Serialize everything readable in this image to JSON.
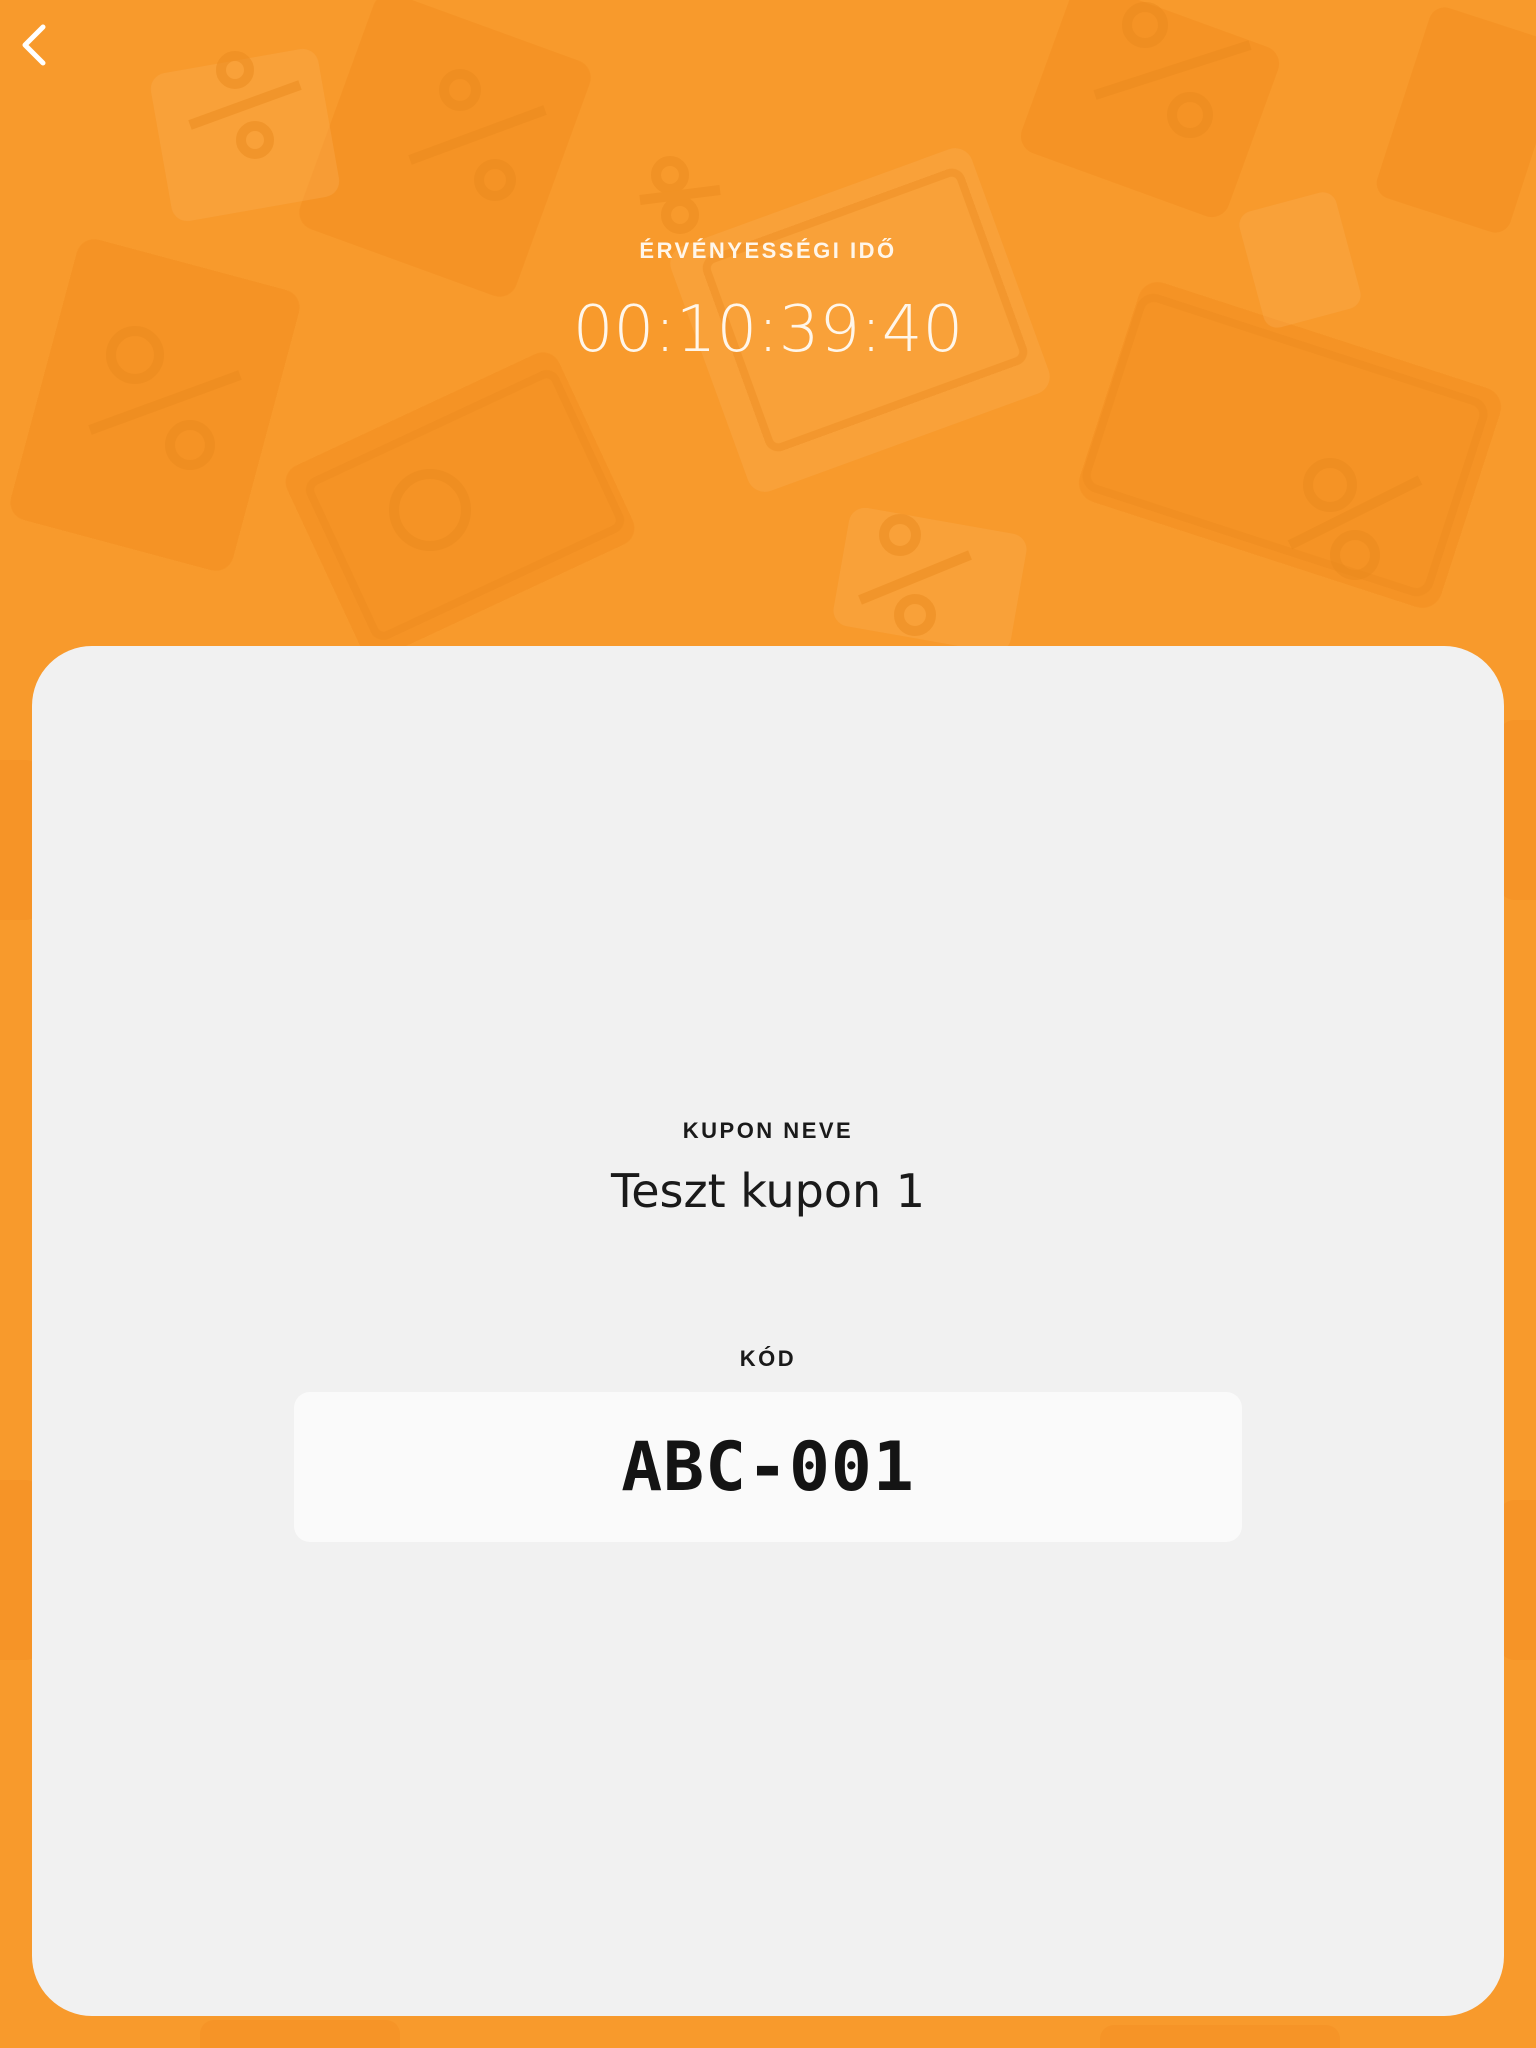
{
  "colors": {
    "background": "#f89a2c",
    "card": "#f1f1f1",
    "code_box": "#fafafa",
    "text_dark": "#1a1a1a",
    "text_light": "#fff6ea"
  },
  "nav": {
    "back_icon": "chevron-left-icon"
  },
  "header": {
    "validity_label": "ÉRVÉNYESSÉGI IDŐ",
    "validity_timer": "00:10:39:40"
  },
  "coupon": {
    "name_label": "KUPON NEVE",
    "name": "Teszt kupon 1",
    "code_label": "KÓD",
    "code": "ABC-001"
  }
}
